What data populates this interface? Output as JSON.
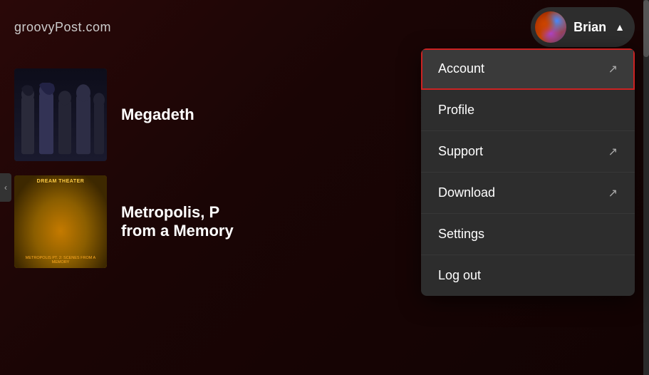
{
  "site": {
    "logo": "groovyPost.com"
  },
  "header": {
    "user": {
      "name": "Brian",
      "avatar_alt": "Brian's avatar"
    },
    "chevron": "▲"
  },
  "dropdown": {
    "items": [
      {
        "id": "account",
        "label": "Account",
        "has_external": true,
        "active": true
      },
      {
        "id": "profile",
        "label": "Profile",
        "has_external": false,
        "active": false
      },
      {
        "id": "support",
        "label": "Support",
        "has_external": true,
        "active": false
      },
      {
        "id": "download",
        "label": "Download",
        "has_external": true,
        "active": false
      },
      {
        "id": "settings",
        "label": "Settings",
        "has_external": false,
        "active": false
      },
      {
        "id": "logout",
        "label": "Log out",
        "has_external": false,
        "active": false
      }
    ],
    "external_icon": "↗"
  },
  "albums": [
    {
      "id": "megadeth",
      "title": "Megadeth",
      "subtitle": ""
    },
    {
      "id": "dream-theater",
      "title": "Metropolis, P",
      "subtitle": "from a Memory"
    }
  ]
}
